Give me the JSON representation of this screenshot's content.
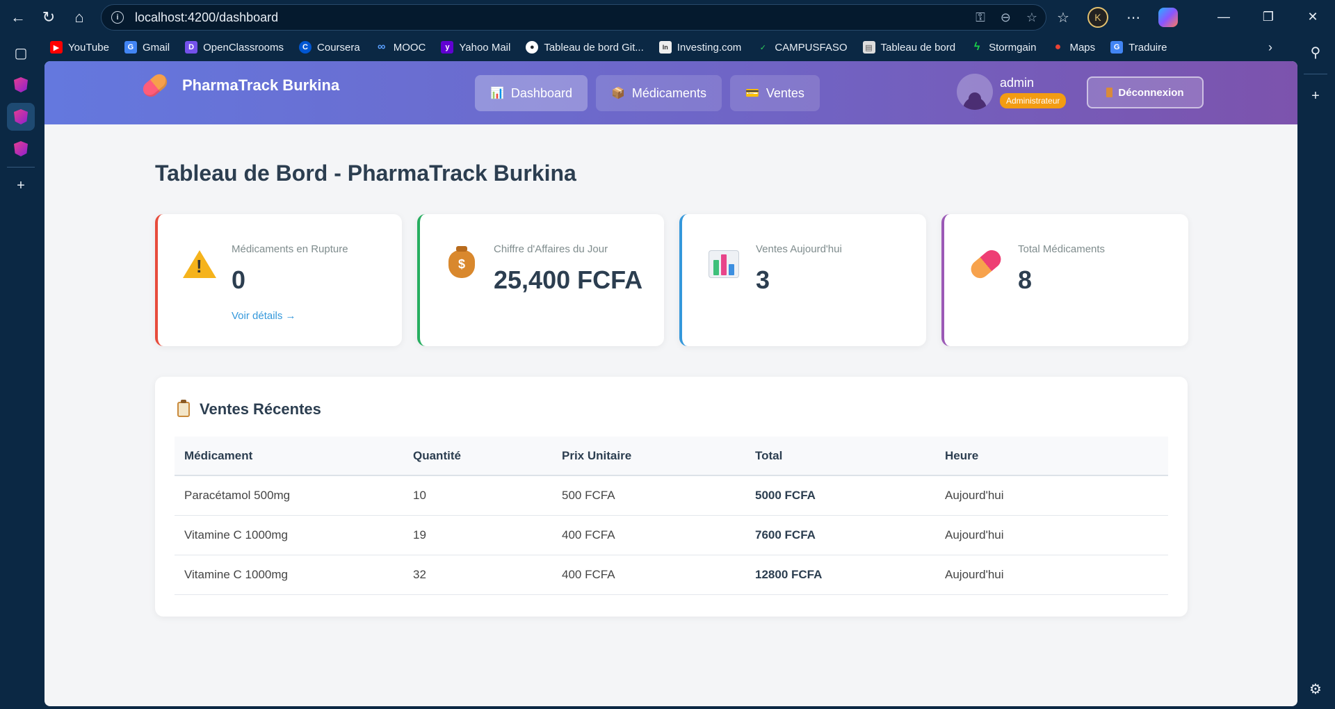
{
  "browser": {
    "url": "localhost:4200/dashboard",
    "bookmarks": [
      {
        "label": "YouTube",
        "icon": "youtube-icon",
        "color": "#ff0000",
        "glyph": "▶"
      },
      {
        "label": "Gmail",
        "icon": "google-icon",
        "color": "#4285f4",
        "glyph": "G"
      },
      {
        "label": "OpenClassrooms",
        "icon": "openclassrooms-icon",
        "color": "#7451eb",
        "glyph": "D"
      },
      {
        "label": "Coursera",
        "icon": "coursera-icon",
        "color": "#0056d2",
        "glyph": "C"
      },
      {
        "label": "MOOC",
        "icon": "mooc-icon",
        "color": "#2a6df4",
        "glyph": "∞"
      },
      {
        "label": "Yahoo Mail",
        "icon": "yahoo-icon",
        "color": "#6001d2",
        "glyph": "y"
      },
      {
        "label": "Tableau de bord Git...",
        "icon": "github-icon",
        "color": "#24292e",
        "glyph": "●"
      },
      {
        "label": "Investing.com",
        "icon": "investing-icon",
        "color": "#333333",
        "glyph": "In"
      },
      {
        "label": "CAMPUSFASO",
        "icon": "campusfaso-icon",
        "color": "#1d8f3a",
        "glyph": "✓"
      },
      {
        "label": "Tableau de bord",
        "icon": "page-icon",
        "color": "#cccccc",
        "glyph": "▤"
      },
      {
        "label": "Stormgain",
        "icon": "stormgain-icon",
        "color": "#19b34a",
        "glyph": "ϟ"
      },
      {
        "label": "Maps",
        "icon": "maps-icon",
        "color": "#34a853",
        "glyph": "●"
      },
      {
        "label": "Traduire",
        "icon": "translate-icon",
        "color": "#4285f4",
        "glyph": "G"
      }
    ]
  },
  "app": {
    "brand": "PharmaTrack Burkina",
    "nav": [
      {
        "label": "Dashboard",
        "icon": "📊"
      },
      {
        "label": "Médicaments",
        "icon": "📦"
      },
      {
        "label": "Ventes",
        "icon": "💳"
      }
    ],
    "user": {
      "name": "admin",
      "role": "Administrateur"
    },
    "logout_label": "Déconnexion"
  },
  "dashboard": {
    "title": "Tableau de Bord - PharmaTrack Burkina",
    "cards": [
      {
        "label": "Médicaments en Rupture",
        "value": "0",
        "link": "Voir détails →"
      },
      {
        "label": "Chiffre d'Affaires du Jour",
        "value": "25,400 FCFA"
      },
      {
        "label": "Ventes Aujourd'hui",
        "value": "3"
      },
      {
        "label": "Total Médicaments",
        "value": "8"
      }
    ],
    "recent_sales": {
      "title": "Ventes Récentes",
      "columns": [
        "Médicament",
        "Quantité",
        "Prix Unitaire",
        "Total",
        "Heure"
      ],
      "rows": [
        [
          "Paracétamol 500mg",
          "10",
          "500 FCFA",
          "5000 FCFA",
          "Aujourd'hui"
        ],
        [
          "Vitamine C 1000mg",
          "19",
          "400 FCFA",
          "7600 FCFA",
          "Aujourd'hui"
        ],
        [
          "Vitamine C 1000mg",
          "32",
          "400 FCFA",
          "12800 FCFA",
          "Aujourd'hui"
        ]
      ]
    }
  }
}
